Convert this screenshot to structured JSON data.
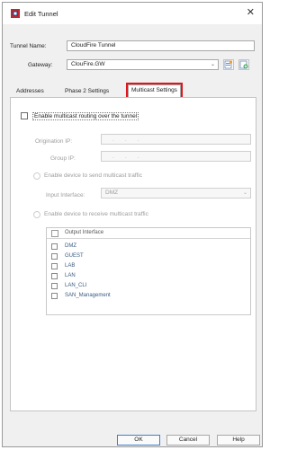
{
  "window": {
    "title": "Edit Tunnel",
    "close_glyph": "✕"
  },
  "tunnel_name": {
    "label": "Tunnel Name:",
    "value": "CloudFire Tunnel"
  },
  "gateway": {
    "label": "Gateway:",
    "value": "ClouFire.GW",
    "icons": [
      "edit-gateway-icon",
      "new-gateway-icon"
    ]
  },
  "tabs": [
    {
      "label": "Addresses",
      "active": false
    },
    {
      "label": "Phase 2 Settings",
      "active": false
    },
    {
      "label": "Multicast Settings",
      "active": true
    }
  ],
  "multicast": {
    "enable_label": "Enable multicast routing over the tunnel",
    "origination_ip_label": "Origination IP:",
    "group_ip_label": "Group IP:",
    "ip_dots": ".",
    "send_label": "Enable device to send multicast traffic",
    "input_interface_label": "Input Interface:",
    "input_interface_value": "DMZ",
    "receive_label": "Enable device to receive multicast traffic",
    "output_header": "Output Interface",
    "output_interfaces": [
      "DMZ",
      "GUEST",
      "LAB",
      "LAN",
      "LAN_CLI",
      "SAN_Management"
    ]
  },
  "buttons": {
    "ok": "OK",
    "cancel": "Cancel",
    "help": "Help"
  },
  "colors": {
    "highlight": "#e0141b",
    "accent": "#3c7fd1"
  }
}
